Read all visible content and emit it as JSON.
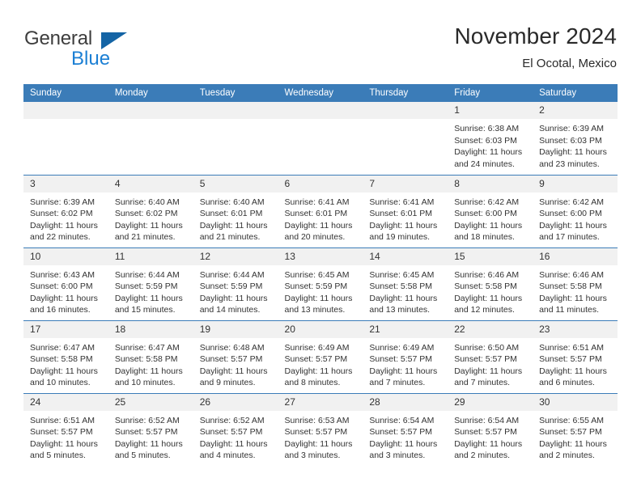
{
  "brand": {
    "name_top": "General",
    "name_bottom": "Blue",
    "triangle_color": "#1464a5",
    "blue_text_color": "#1b7fd4"
  },
  "header": {
    "title": "November 2024",
    "subtitle": "El Ocotal, Mexico"
  },
  "theme": {
    "header_bg": "#3b7cb8",
    "header_text": "#ffffff",
    "daynum_bg": "#f1f1f1",
    "cell_text": "#333333",
    "row_divider": "#3b7cb8"
  },
  "weekday_headers": [
    "Sunday",
    "Monday",
    "Tuesday",
    "Wednesday",
    "Thursday",
    "Friday",
    "Saturday"
  ],
  "weeks": [
    [
      {
        "day": "",
        "lines": []
      },
      {
        "day": "",
        "lines": []
      },
      {
        "day": "",
        "lines": []
      },
      {
        "day": "",
        "lines": []
      },
      {
        "day": "",
        "lines": []
      },
      {
        "day": "1",
        "lines": [
          "Sunrise: 6:38 AM",
          "Sunset: 6:03 PM",
          "Daylight: 11 hours",
          "and 24 minutes."
        ]
      },
      {
        "day": "2",
        "lines": [
          "Sunrise: 6:39 AM",
          "Sunset: 6:03 PM",
          "Daylight: 11 hours",
          "and 23 minutes."
        ]
      }
    ],
    [
      {
        "day": "3",
        "lines": [
          "Sunrise: 6:39 AM",
          "Sunset: 6:02 PM",
          "Daylight: 11 hours",
          "and 22 minutes."
        ]
      },
      {
        "day": "4",
        "lines": [
          "Sunrise: 6:40 AM",
          "Sunset: 6:02 PM",
          "Daylight: 11 hours",
          "and 21 minutes."
        ]
      },
      {
        "day": "5",
        "lines": [
          "Sunrise: 6:40 AM",
          "Sunset: 6:01 PM",
          "Daylight: 11 hours",
          "and 21 minutes."
        ]
      },
      {
        "day": "6",
        "lines": [
          "Sunrise: 6:41 AM",
          "Sunset: 6:01 PM",
          "Daylight: 11 hours",
          "and 20 minutes."
        ]
      },
      {
        "day": "7",
        "lines": [
          "Sunrise: 6:41 AM",
          "Sunset: 6:01 PM",
          "Daylight: 11 hours",
          "and 19 minutes."
        ]
      },
      {
        "day": "8",
        "lines": [
          "Sunrise: 6:42 AM",
          "Sunset: 6:00 PM",
          "Daylight: 11 hours",
          "and 18 minutes."
        ]
      },
      {
        "day": "9",
        "lines": [
          "Sunrise: 6:42 AM",
          "Sunset: 6:00 PM",
          "Daylight: 11 hours",
          "and 17 minutes."
        ]
      }
    ],
    [
      {
        "day": "10",
        "lines": [
          "Sunrise: 6:43 AM",
          "Sunset: 6:00 PM",
          "Daylight: 11 hours",
          "and 16 minutes."
        ]
      },
      {
        "day": "11",
        "lines": [
          "Sunrise: 6:44 AM",
          "Sunset: 5:59 PM",
          "Daylight: 11 hours",
          "and 15 minutes."
        ]
      },
      {
        "day": "12",
        "lines": [
          "Sunrise: 6:44 AM",
          "Sunset: 5:59 PM",
          "Daylight: 11 hours",
          "and 14 minutes."
        ]
      },
      {
        "day": "13",
        "lines": [
          "Sunrise: 6:45 AM",
          "Sunset: 5:59 PM",
          "Daylight: 11 hours",
          "and 13 minutes."
        ]
      },
      {
        "day": "14",
        "lines": [
          "Sunrise: 6:45 AM",
          "Sunset: 5:58 PM",
          "Daylight: 11 hours",
          "and 13 minutes."
        ]
      },
      {
        "day": "15",
        "lines": [
          "Sunrise: 6:46 AM",
          "Sunset: 5:58 PM",
          "Daylight: 11 hours",
          "and 12 minutes."
        ]
      },
      {
        "day": "16",
        "lines": [
          "Sunrise: 6:46 AM",
          "Sunset: 5:58 PM",
          "Daylight: 11 hours",
          "and 11 minutes."
        ]
      }
    ],
    [
      {
        "day": "17",
        "lines": [
          "Sunrise: 6:47 AM",
          "Sunset: 5:58 PM",
          "Daylight: 11 hours",
          "and 10 minutes."
        ]
      },
      {
        "day": "18",
        "lines": [
          "Sunrise: 6:47 AM",
          "Sunset: 5:58 PM",
          "Daylight: 11 hours",
          "and 10 minutes."
        ]
      },
      {
        "day": "19",
        "lines": [
          "Sunrise: 6:48 AM",
          "Sunset: 5:57 PM",
          "Daylight: 11 hours",
          "and 9 minutes."
        ]
      },
      {
        "day": "20",
        "lines": [
          "Sunrise: 6:49 AM",
          "Sunset: 5:57 PM",
          "Daylight: 11 hours",
          "and 8 minutes."
        ]
      },
      {
        "day": "21",
        "lines": [
          "Sunrise: 6:49 AM",
          "Sunset: 5:57 PM",
          "Daylight: 11 hours",
          "and 7 minutes."
        ]
      },
      {
        "day": "22",
        "lines": [
          "Sunrise: 6:50 AM",
          "Sunset: 5:57 PM",
          "Daylight: 11 hours",
          "and 7 minutes."
        ]
      },
      {
        "day": "23",
        "lines": [
          "Sunrise: 6:51 AM",
          "Sunset: 5:57 PM",
          "Daylight: 11 hours",
          "and 6 minutes."
        ]
      }
    ],
    [
      {
        "day": "24",
        "lines": [
          "Sunrise: 6:51 AM",
          "Sunset: 5:57 PM",
          "Daylight: 11 hours",
          "and 5 minutes."
        ]
      },
      {
        "day": "25",
        "lines": [
          "Sunrise: 6:52 AM",
          "Sunset: 5:57 PM",
          "Daylight: 11 hours",
          "and 5 minutes."
        ]
      },
      {
        "day": "26",
        "lines": [
          "Sunrise: 6:52 AM",
          "Sunset: 5:57 PM",
          "Daylight: 11 hours",
          "and 4 minutes."
        ]
      },
      {
        "day": "27",
        "lines": [
          "Sunrise: 6:53 AM",
          "Sunset: 5:57 PM",
          "Daylight: 11 hours",
          "and 3 minutes."
        ]
      },
      {
        "day": "28",
        "lines": [
          "Sunrise: 6:54 AM",
          "Sunset: 5:57 PM",
          "Daylight: 11 hours",
          "and 3 minutes."
        ]
      },
      {
        "day": "29",
        "lines": [
          "Sunrise: 6:54 AM",
          "Sunset: 5:57 PM",
          "Daylight: 11 hours",
          "and 2 minutes."
        ]
      },
      {
        "day": "30",
        "lines": [
          "Sunrise: 6:55 AM",
          "Sunset: 5:57 PM",
          "Daylight: 11 hours",
          "and 2 minutes."
        ]
      }
    ]
  ]
}
